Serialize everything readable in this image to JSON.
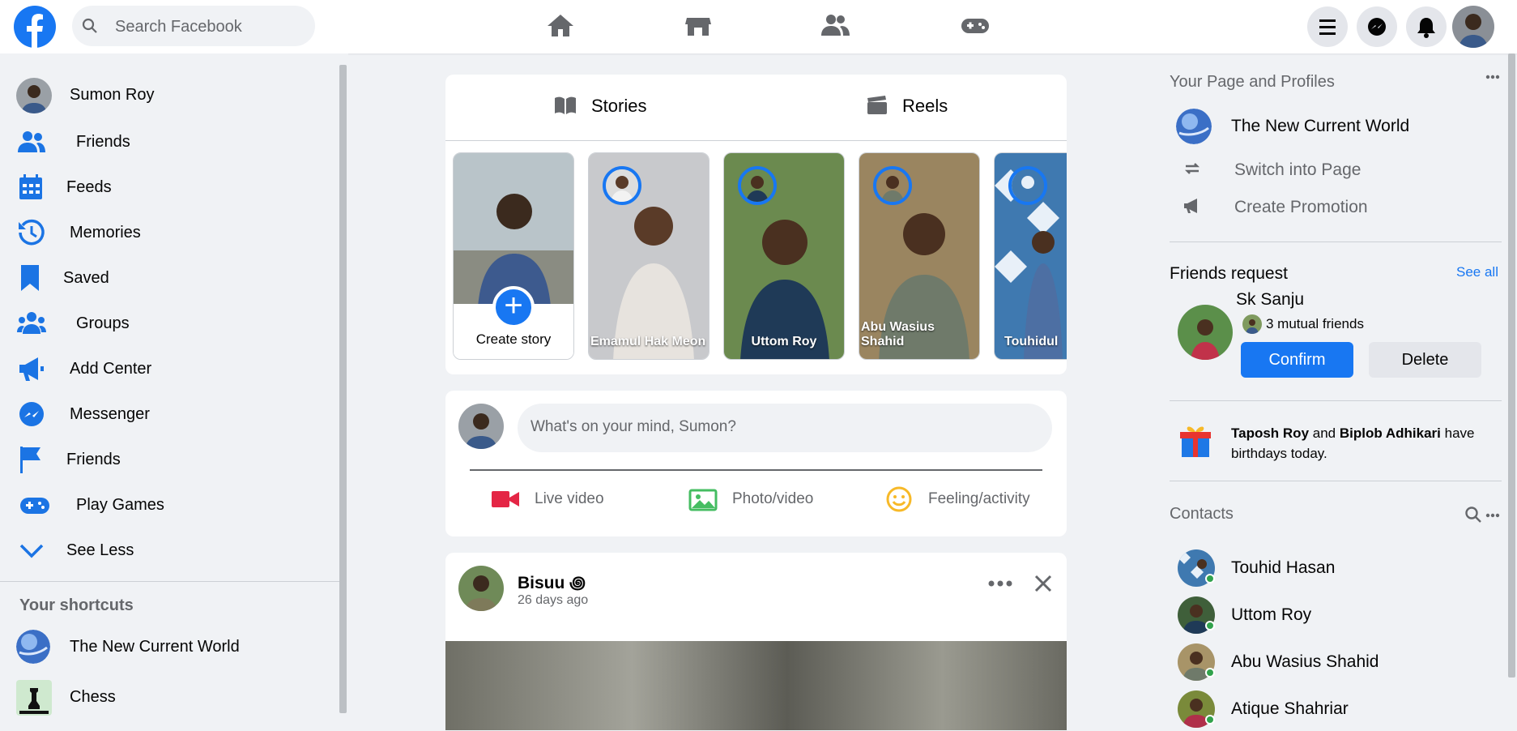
{
  "search": {
    "placeholder": "Search Facebook"
  },
  "left_menu": {
    "profile_name": "Sumon Roy",
    "items": [
      {
        "label": "Friends",
        "icon": "friends-icon"
      },
      {
        "label": "Feeds",
        "icon": "calendar-icon"
      },
      {
        "label": "Memories",
        "icon": "history-icon"
      },
      {
        "label": "Saved",
        "icon": "bookmark-icon"
      },
      {
        "label": "Groups",
        "icon": "groups-icon"
      },
      {
        "label": "Add Center",
        "icon": "megaphone-icon"
      },
      {
        "label": "Messenger",
        "icon": "messenger-icon"
      },
      {
        "label": "Friends",
        "icon": "flag-icon"
      },
      {
        "label": "Play Games",
        "icon": "gamepad-icon"
      },
      {
        "label": "See Less",
        "icon": "chevron-down-icon"
      }
    ],
    "shortcuts_title": "Your shortcuts",
    "shortcuts": [
      "The New Current World",
      "Chess"
    ]
  },
  "stories": {
    "tabs": [
      "Stories",
      "Reels"
    ],
    "create_label": "Create story",
    "items": [
      "Emamul Hak Meon",
      "Uttom Roy",
      "Abu Wasius Shahid",
      "Touhidul"
    ]
  },
  "composer": {
    "placeholder": "What's on your mind, Sumon?",
    "actions": [
      "Live video",
      "Photo/video",
      "Feeling/activity"
    ]
  },
  "post": {
    "author": "Bisuu ꩜",
    "time": "26 days ago"
  },
  "right": {
    "pages_title": "Your Page and Profiles",
    "page_name": "The New Current World",
    "page_actions": [
      "Switch into Page",
      "Create Promotion"
    ],
    "friend_requests_title": "Friends request",
    "see_all": "See all",
    "request_name": "Sk Sanju",
    "request_mutual": "3 mutual friends",
    "confirm": "Confirm",
    "delete": "Delete",
    "birthday_name1": "Taposh Roy",
    "birthday_and": "and",
    "birthday_name2": "Biplob Adhikari",
    "birthday_rest": "have birthdays today.",
    "contacts_title": "Contacts",
    "contacts": [
      "Touhid Hasan",
      "Uttom Roy",
      "Abu Wasius Shahid",
      "Atique Shahriar"
    ]
  },
  "colors": {
    "accent": "#1877f2",
    "background": "#f0f2f5",
    "online": "#31a24c"
  }
}
